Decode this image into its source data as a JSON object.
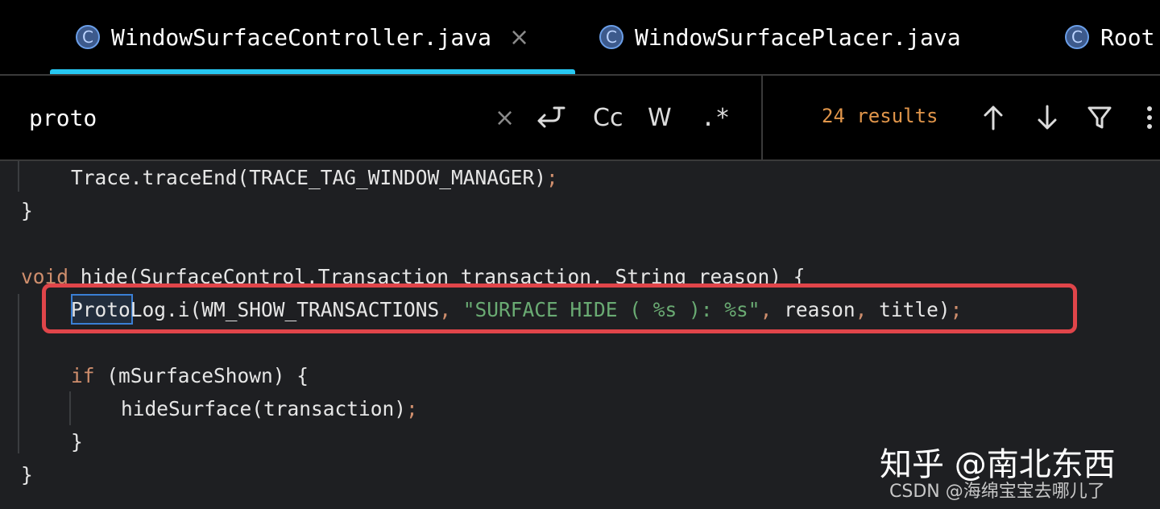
{
  "tabs": [
    {
      "label": "WindowSurfaceController.java",
      "icon": "class-icon",
      "icon_glyph": "C",
      "active": true,
      "close": "×"
    },
    {
      "label": "WindowSurfacePlacer.java",
      "icon": "class-icon",
      "icon_glyph": "C",
      "active": false
    },
    {
      "label": "Root",
      "icon": "class-icon",
      "icon_glyph": "C",
      "active": false
    }
  ],
  "search": {
    "value": "proto",
    "clear": "×",
    "match_case": "Cc",
    "whole_word": "W",
    "regex": ".*",
    "results": "24 results"
  },
  "code": {
    "line1": {
      "text": "Trace.traceEnd(TRACE_TAG_WINDOW_MANAGER)",
      "semi": ";"
    },
    "line2": {
      "text": "}"
    },
    "line4": {
      "kw": "void",
      "text": " hide(SurfaceControl.Transaction transaction, String reason) {"
    },
    "line5": {
      "match": "Proto",
      "a": "Log.i(WM_SHOW_TRANSACTIONS",
      "c1": ", ",
      "s": "\"SURFACE HIDE ( %s ): %s\"",
      "c2": ", ",
      "b": "reason",
      "c3": ", ",
      "d": "title)",
      "semi": ";"
    },
    "line7": {
      "kw": "if",
      "text": " (mSurfaceShown) {"
    },
    "line8": {
      "text": "hideSurface(transaction)",
      "semi": ";"
    },
    "line9": {
      "text": "}"
    },
    "line10": {
      "text": "}"
    }
  },
  "watermark": {
    "zhihu": "知乎 @南北东西",
    "csdn": "CSDN @海绵宝宝去哪儿了"
  },
  "colors": {
    "accent_tab": "#27c8f3",
    "keyword": "#cf8e6d",
    "string": "#6aab73",
    "results": "#e0954a",
    "highlight_box": "#e0454a"
  }
}
